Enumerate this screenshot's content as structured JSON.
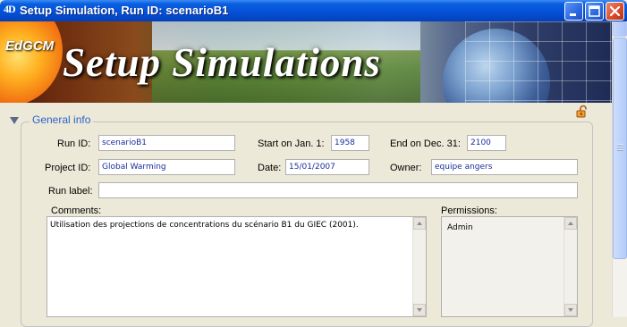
{
  "window": {
    "icon_text": "4D",
    "title": "Setup Simulation, Run ID: scenarioB1"
  },
  "banner": {
    "brand": "EdGCM",
    "title": "Setup Simulations"
  },
  "general_info": {
    "legend": "General info",
    "run_id": {
      "label": "Run ID:",
      "value": "scenarioB1"
    },
    "start": {
      "label": "Start on Jan. 1:",
      "value": "1958"
    },
    "end": {
      "label": "End on Dec. 31:",
      "value": "2100"
    },
    "project_id": {
      "label": "Project ID:",
      "value": "Global Warming"
    },
    "date": {
      "label": "Date:",
      "value": "15/01/2007"
    },
    "owner": {
      "label": "Owner:",
      "value": "equipe angers"
    },
    "run_label": {
      "label": "Run label:",
      "value": ""
    },
    "comments": {
      "label": "Comments:",
      "value": "Utilisation des projections de concentrations du scénario B1 du GIEC (2001)."
    },
    "permissions": {
      "label": "Permissions:",
      "items": [
        "Admin"
      ]
    }
  },
  "icons": {
    "app": "4d-icon",
    "minimize": "minimize-icon",
    "maximize": "maximize-icon",
    "close": "close-icon",
    "lock": "unlocked-padlock-icon",
    "collapse": "collapse-arrow-icon"
  }
}
